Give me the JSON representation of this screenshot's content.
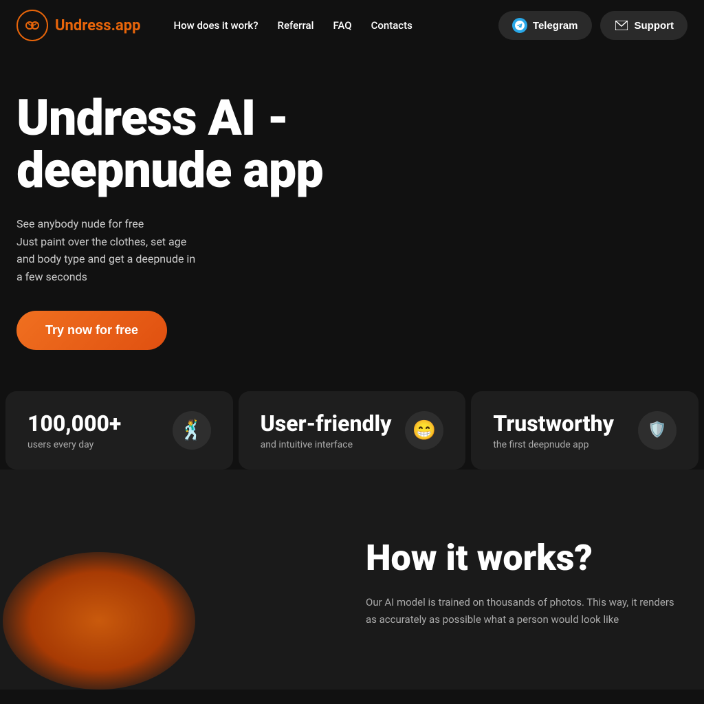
{
  "nav": {
    "logo_icon": "◎",
    "brand_prefix": "Un",
    "brand_suffix": "dress.app",
    "links": [
      {
        "label": "How does it work?",
        "id": "how-it-works"
      },
      {
        "label": "Referral",
        "id": "referral"
      },
      {
        "label": "FAQ",
        "id": "faq"
      },
      {
        "label": "Contacts",
        "id": "contacts"
      }
    ],
    "telegram_label": "Telegram",
    "support_label": "Support"
  },
  "hero": {
    "title": "Undress AI - deepnude app",
    "description_line1": "See anybody nude for free",
    "description_line2": "Just paint over the clothes, set age",
    "description_line3": "and body type and get a deepnude in",
    "description_line4": "a few seconds",
    "cta_label": "Try now for free"
  },
  "stats": [
    {
      "number": "100,000+",
      "label": "users every day",
      "emoji": "🕺💃"
    },
    {
      "number": "User-friendly",
      "label": "and intuitive interface",
      "emoji": "😁"
    },
    {
      "number": "Trustworthy",
      "label": "the first deepnude app",
      "emoji": "🛡️"
    }
  ],
  "how_it_works": {
    "title": "How it works?",
    "description": "Our AI model is trained on thousands of photos. This way, it renders as accurately as possible what a person would look like"
  },
  "colors": {
    "accent": "#e8650a",
    "bg_dark": "#111111",
    "bg_card": "#1e1e1e",
    "bg_lower": "#1a1a1a",
    "text_muted": "#aaaaaa"
  }
}
